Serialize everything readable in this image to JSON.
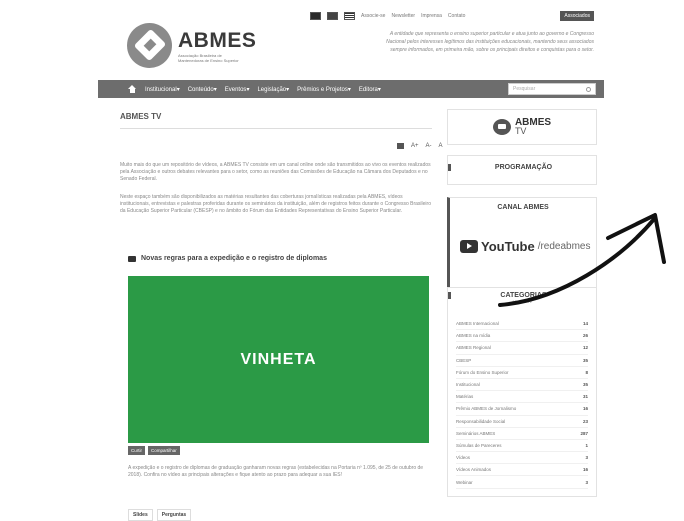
{
  "utility": {
    "links": [
      "Associe-se",
      "Newsletter",
      "Imprensa",
      "Contato"
    ],
    "assoc_button": "Associados"
  },
  "brand": {
    "name": "ABMES",
    "sub": "Associação Brasileira de Mantenedoras de Ensino Superior",
    "tagline": "A entidade que representa o ensino superior particular e atua junto ao governo e Congresso Nacional pelos interesses legítimos das instituições educacionais, mantendo seus associados sempre informados, em primeira mão, sobre os principais direitos e conquistas para o setor."
  },
  "nav": {
    "items": [
      "Institucional",
      "Conteúdo",
      "Eventos",
      "Legislação",
      "Prêmios e Projetos",
      "Editora"
    ],
    "search_placeholder": "Pesquisar"
  },
  "main": {
    "title": "ABMES TV",
    "font_tools": [
      "A+",
      "A-",
      "A"
    ],
    "paragraph1": "Muito mais do que um repositório de vídeos, a ABMES TV consiste em um canal online onde são transmitidos ao vivo os eventos realizados pela Associação e outros debates relevantes para o setor, como as reuniões das Comissões de Educação na Câmara dos Deputados e no Senado Federal.",
    "paragraph2": "Neste espaço também são disponibilizados as matérias resultantes das coberturas jornalísticas realizadas pela ABMES, vídeos institucionais, entrevistas e palestras proferidas durante os seminários da instituição, além de registros feitos durante o Congresso Brasileiro da Educação Superior Particular (CBESP) e no âmbito do Fórum das Entidades Representativas do Ensino Superior Particular.",
    "video_title": "Novas regras para a expedição e o registro de diplomas",
    "video_overlay": "VINHETA",
    "share": [
      "Curtir",
      "Compartilhar"
    ],
    "video_desc": "A expedição e o registro de diplomas de graduação ganharam novas regras (estabelecidas na Portaria nº 1.095, de 25 de outubro de 2018). Confira no vídeo as principais alterações e fique atento ao prazo para adequar a sua IES!",
    "tabs": [
      "Slides",
      "Perguntas"
    ]
  },
  "sidebar": {
    "tv_title": "ABMES",
    "tv_sub": "TV",
    "programacao": "PROGRAMAÇÃO",
    "canal": "CANAL ABMES",
    "youtube_word": "YouTube",
    "youtube_handle": "/redeabmes",
    "categorias": "CATEGORIAS",
    "categorias_sub": "ABMES TV",
    "categories": [
      {
        "name": "ABMES Internacional",
        "count": "14"
      },
      {
        "name": "ABMES na mídia",
        "count": "26"
      },
      {
        "name": "ABMES Regional",
        "count": "12"
      },
      {
        "name": "CBESP",
        "count": "35"
      },
      {
        "name": "Fórum do Ensino Superior",
        "count": "8"
      },
      {
        "name": "Institucional",
        "count": "35"
      },
      {
        "name": "Matérias",
        "count": "31"
      },
      {
        "name": "Prêmio ABMES de Jornalismo",
        "count": "16"
      },
      {
        "name": "Responsabilidade Social",
        "count": "23"
      },
      {
        "name": "Seminários ABMES",
        "count": "287"
      },
      {
        "name": "Súmulas de Pareceres",
        "count": "1"
      },
      {
        "name": "Vídeos",
        "count": "3"
      },
      {
        "name": "Vídeos Animados",
        "count": "16"
      },
      {
        "name": "Webinar",
        "count": "3"
      }
    ]
  }
}
